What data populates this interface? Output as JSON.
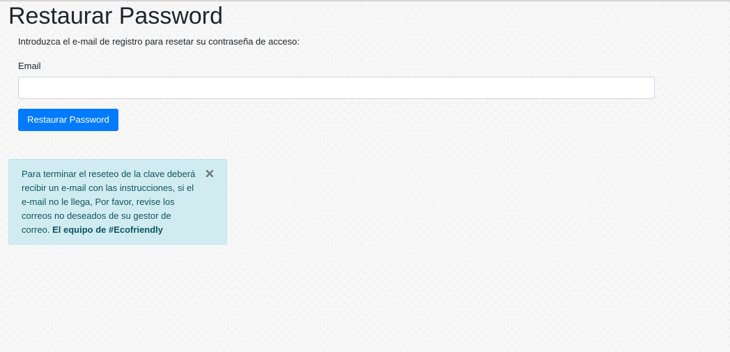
{
  "page": {
    "title": "Restaurar Password",
    "intro": "Introduzca el e-mail de registro para resetar su contraseña de acceso:"
  },
  "form": {
    "email_label": "Email",
    "email_value": "",
    "email_placeholder": "",
    "submit_label": "Restaurar Password"
  },
  "alert": {
    "message": "Para terminar el reseteo de la clave deberá recibir un e-mail con las instrucciones, si el e-mail no le llega, Por favor, revise los correos no deseados de su gestor de correo. ",
    "signature": "El equipo de #Ecofriendly",
    "close_icon": "close-icon"
  },
  "colors": {
    "primary": "#007bff",
    "alert_bg": "#d1ecf1",
    "alert_border": "#bee5eb",
    "alert_text": "#0c5460"
  }
}
